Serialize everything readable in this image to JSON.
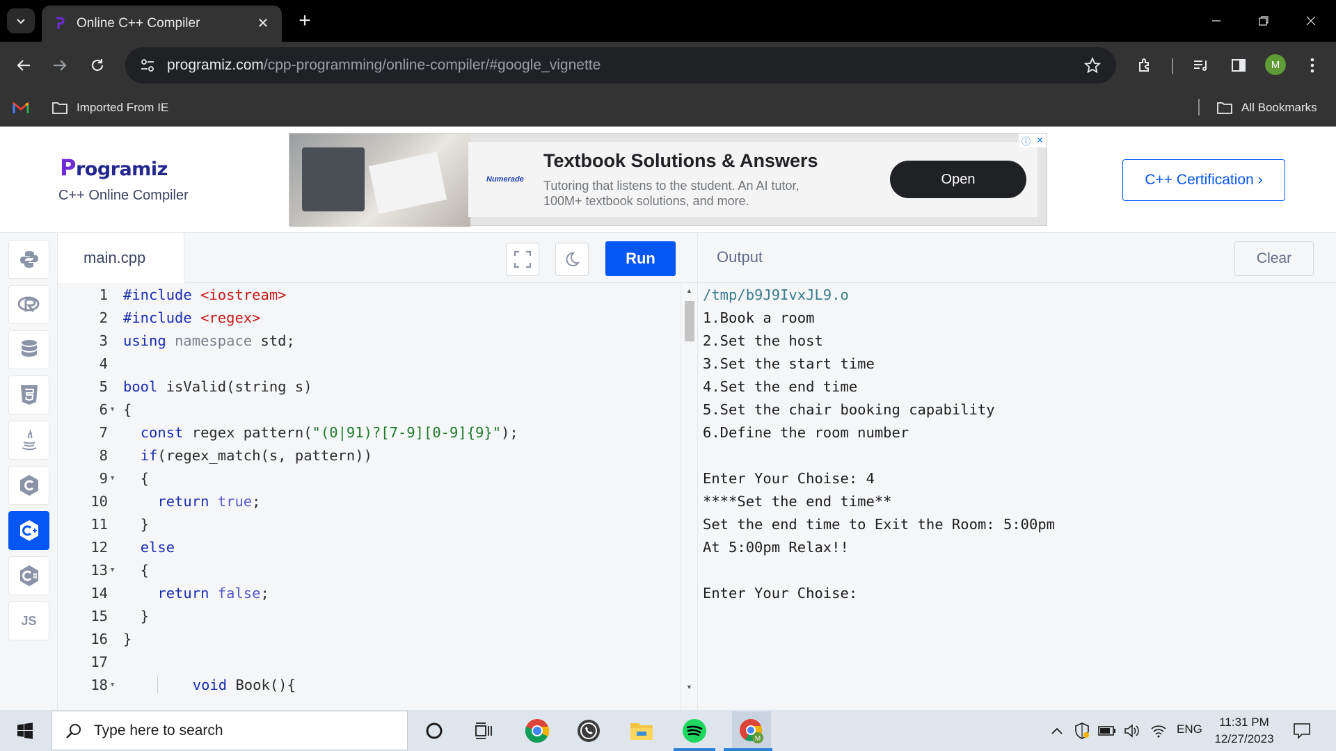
{
  "browser": {
    "tab_title": "Online C++ Compiler",
    "url_host": "programiz.com",
    "url_path": "/cpp-programming/online-compiler/#google_vignette",
    "avatar_letter": "M",
    "bookmarks": {
      "imported": "Imported From IE",
      "all": "All Bookmarks"
    }
  },
  "header": {
    "logo_text": "rogramiz",
    "logo_p": "P",
    "subtitle": "C++ Online Compiler",
    "certification_button": "C++ Certification ›"
  },
  "ad": {
    "brand": "Numerade",
    "title": "Textbook Solutions & Answers",
    "description": "Tutoring that listens to the student. An AI tutor, 100M+ textbook solutions, and more.",
    "cta": "Open"
  },
  "sidebar": {
    "items": [
      {
        "icon": "python-icon",
        "active": false
      },
      {
        "icon": "r-lang-icon",
        "active": false
      },
      {
        "icon": "sql-database-icon",
        "active": false
      },
      {
        "icon": "html5-icon",
        "active": false
      },
      {
        "icon": "java-icon",
        "active": false
      },
      {
        "icon": "c-lang-icon",
        "active": false
      },
      {
        "icon": "cpp-lang-icon",
        "active": true
      },
      {
        "icon": "csharp-lang-icon",
        "active": false
      },
      {
        "icon": "javascript-icon",
        "active": false,
        "label": "JS"
      }
    ]
  },
  "editor": {
    "file_name": "main.cpp",
    "run_label": "Run",
    "lines": [
      {
        "n": "1",
        "fold": false
      },
      {
        "n": "2",
        "fold": false
      },
      {
        "n": "3",
        "fold": false
      },
      {
        "n": "4",
        "fold": false
      },
      {
        "n": "5",
        "fold": false
      },
      {
        "n": "6",
        "fold": true
      },
      {
        "n": "7",
        "fold": false
      },
      {
        "n": "8",
        "fold": false
      },
      {
        "n": "9",
        "fold": true
      },
      {
        "n": "10",
        "fold": false
      },
      {
        "n": "11",
        "fold": false
      },
      {
        "n": "12",
        "fold": false
      },
      {
        "n": "13",
        "fold": true
      },
      {
        "n": "14",
        "fold": false
      },
      {
        "n": "15",
        "fold": false
      },
      {
        "n": "16",
        "fold": false
      },
      {
        "n": "17",
        "fold": false
      },
      {
        "n": "18",
        "fold": true
      }
    ],
    "code": [
      "#include <iostream>",
      "#include <regex>",
      "using namespace std;",
      "",
      "bool isValid(string s)",
      "{",
      "  const regex pattern(\"(0|91)?[7-9][0-9]{9}\");",
      "  if(regex_match(s, pattern))",
      "  {",
      "    return true;",
      "  }",
      "  else",
      "  {",
      "    return false;",
      "  }",
      "}",
      "",
      "        void Book(){"
    ]
  },
  "output": {
    "title": "Output",
    "clear_label": "Clear",
    "lines": [
      "/tmp/b9J9IvxJL9.o",
      "1.Book a room",
      "2.Set the host",
      "3.Set the start time",
      "4.Set the end time",
      "5.Set the chair booking capability",
      "6.Define the room number",
      "",
      "Enter Your Choise: 4",
      "****Set the end time**",
      "Set the end time to Exit the Room: 5:00pm",
      "At 5:00pm Relax!!",
      "",
      "Enter Your Choise:"
    ]
  },
  "taskbar": {
    "search_placeholder": "Type here to search",
    "language": "ENG",
    "time": "11:31 PM",
    "date": "12/27/2023"
  }
}
